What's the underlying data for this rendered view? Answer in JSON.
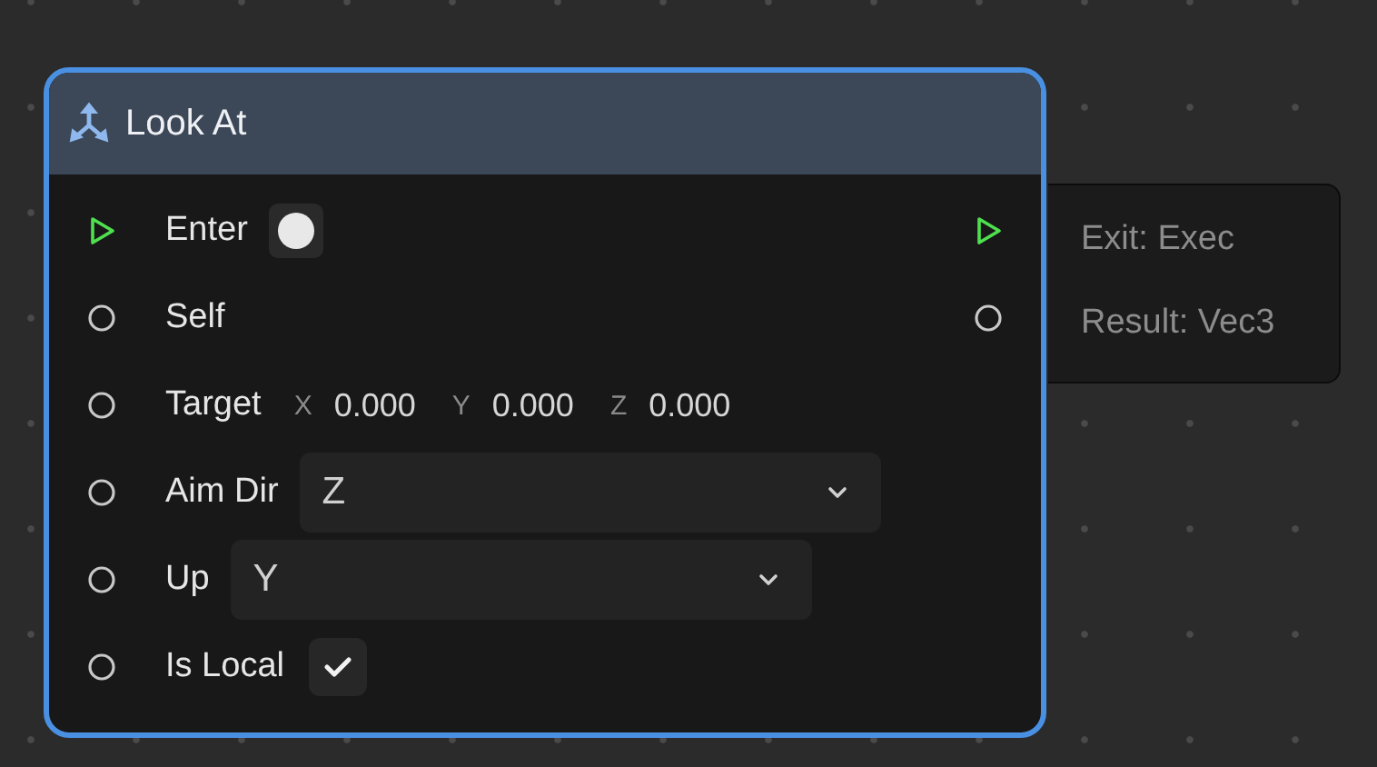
{
  "node": {
    "title": "Look At",
    "selected": true,
    "inputs": [
      {
        "kind": "exec",
        "label": "Enter",
        "control": {
          "kind": "trigger"
        }
      },
      {
        "kind": "data",
        "label": "Self"
      },
      {
        "kind": "data",
        "label": "Target",
        "control": {
          "kind": "vector",
          "components": [
            {
              "axis": "X",
              "value": "0.000"
            },
            {
              "axis": "Y",
              "value": "0.000"
            },
            {
              "axis": "Z",
              "value": "0.000"
            }
          ]
        }
      },
      {
        "kind": "data",
        "label": "Aim Dir",
        "control": {
          "kind": "dropdown",
          "value": "Z"
        }
      },
      {
        "kind": "data",
        "label": "Up",
        "control": {
          "kind": "dropdown",
          "value": "Y"
        }
      },
      {
        "kind": "data",
        "label": "Is Local",
        "control": {
          "kind": "checkbox",
          "checked": true
        }
      }
    ],
    "outputs": [
      {
        "kind": "exec",
        "label": "Exit: Exec"
      },
      {
        "kind": "data",
        "label": "Result: Vec3"
      }
    ]
  }
}
